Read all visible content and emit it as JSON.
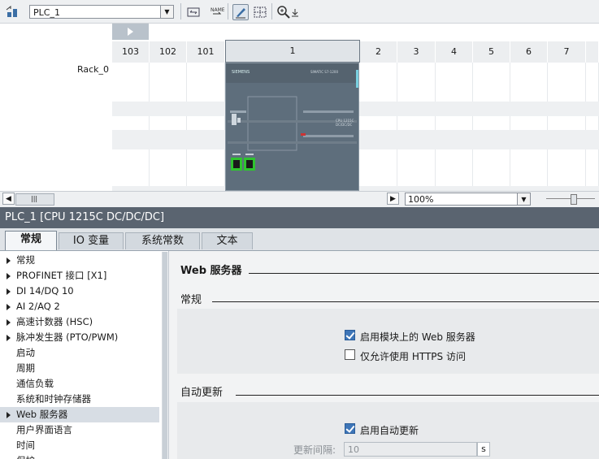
{
  "toolbar": {
    "device_select_value": "PLC_1",
    "icons": [
      "network-view-icon",
      "swap-icon",
      "show-name-icon",
      "draw-icon",
      "grid-icon",
      "zoom-icon",
      "download-icon"
    ]
  },
  "rack": {
    "label": "Rack_0",
    "slots": [
      "103",
      "102",
      "101",
      "1",
      "2",
      "3",
      "4",
      "5",
      "6",
      "7"
    ],
    "cpu_brand": "SIEMENS",
    "cpu_model": "SIMATIC S7-1200",
    "cpu_face_text": "CPU 1215C\nDC/DC/DC"
  },
  "scroll": {
    "zoom_value": "100%"
  },
  "inspector": {
    "title": "PLC_1 [CPU 1215C DC/DC/DC]",
    "tabs": [
      "常规",
      "IO 变量",
      "系统常数",
      "文本"
    ],
    "nav_items": [
      {
        "label": "常规",
        "expandable": true
      },
      {
        "label": "PROFINET 接口 [X1]",
        "expandable": true
      },
      {
        "label": "DI 14/DQ 10",
        "expandable": true
      },
      {
        "label": "AI 2/AQ 2",
        "expandable": true
      },
      {
        "label": "高速计数器 (HSC)",
        "expandable": true
      },
      {
        "label": "脉冲发生器 (PTO/PWM)",
        "expandable": true
      },
      {
        "label": "启动",
        "expandable": false
      },
      {
        "label": "周期",
        "expandable": false
      },
      {
        "label": "通信负载",
        "expandable": false
      },
      {
        "label": "系统和时钟存储器",
        "expandable": false
      },
      {
        "label": "Web 服务器",
        "expandable": true
      },
      {
        "label": "用户界面语言",
        "expandable": false
      },
      {
        "label": "时间",
        "expandable": false
      },
      {
        "label": "保护",
        "expandable": false
      }
    ],
    "content": {
      "section_title": "Web 服务器",
      "general_title": "常规",
      "enable_web_label": "启用模块上的 Web 服务器",
      "enable_web_checked": true,
      "https_only_label": "仅允许使用 HTTPS 访问",
      "https_only_checked": false,
      "auto_update_title": "自动更新",
      "auto_update_label": "启用自动更新",
      "auto_update_checked": true,
      "interval_label": "更新间隔:",
      "interval_value": "10",
      "interval_unit": "s"
    }
  },
  "colors": {
    "title_bar": "#5a6470",
    "accent_blue": "#3e76b8",
    "cpu_body": "#5e6e7c",
    "port_green": "#2fc42f"
  }
}
